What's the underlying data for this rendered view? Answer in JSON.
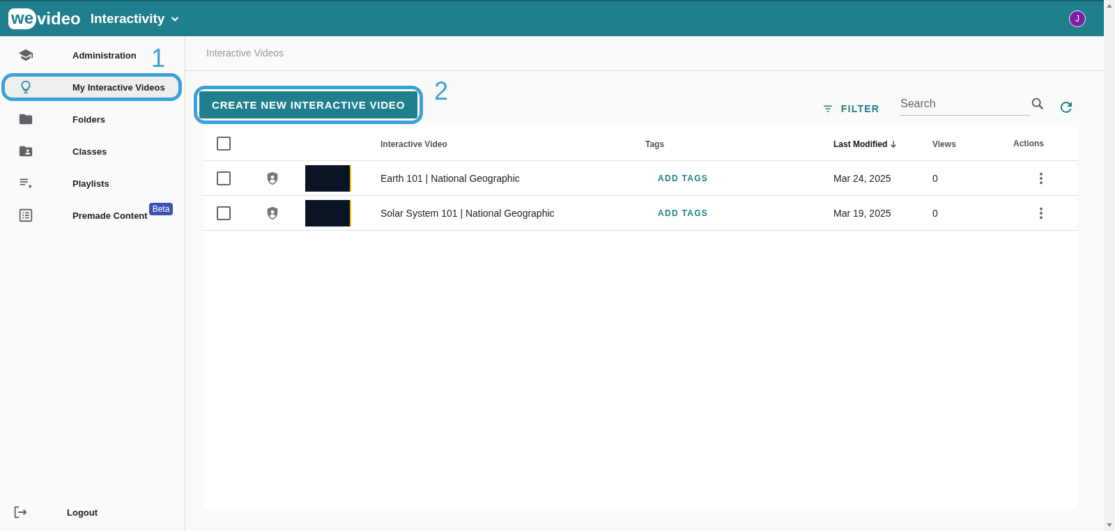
{
  "app_bar": {
    "logo": [
      "we",
      "video"
    ],
    "app_name": "Interactivity",
    "avatar": "J"
  },
  "sidebar": {
    "items": [
      {
        "label": "Administration",
        "selected": false
      },
      {
        "label": "My Interactive Videos",
        "selected": true,
        "callout": "1"
      },
      {
        "label": "Folders",
        "selected": false
      },
      {
        "label": "Classes",
        "selected": false
      },
      {
        "label": "Playlists",
        "selected": false
      },
      {
        "label": "Premade Content",
        "selected": false,
        "badge": "Beta"
      }
    ],
    "logout": "Logout"
  },
  "breadcrumb": "Interactive Videos",
  "create_button": {
    "label": "CREATE NEW INTERACTIVE VIDEO",
    "callout": "2"
  },
  "filter_button": "FILTER",
  "search": {
    "placeholder": "Search"
  },
  "table": {
    "all_checked": false,
    "columns": [
      {
        "label": "Interactive Video",
        "sorted": false
      },
      {
        "label": "Tags",
        "sorted": false
      },
      {
        "label": "Last Modified",
        "sorted": true
      },
      {
        "label": "Views",
        "sorted": false
      },
      {
        "label": "Actions",
        "sorted": false
      }
    ],
    "rows": [
      {
        "checked": false,
        "title": "Earth 101 | National Geographic",
        "tags": "ADD TAGS",
        "last_modified": "Mar 24, 2025",
        "views": "0"
      },
      {
        "checked": false,
        "title": "Solar System 101 | National Geographic",
        "tags": "ADD TAGS",
        "last_modified": "Mar 19, 2025",
        "views": "0"
      }
    ]
  }
}
